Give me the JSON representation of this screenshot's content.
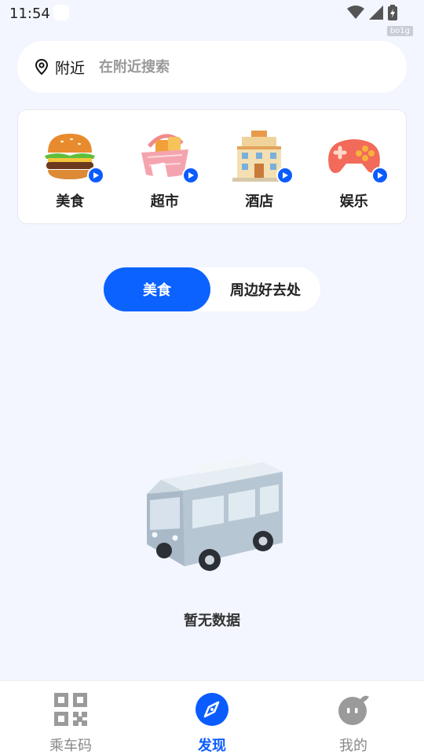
{
  "status_bar": {
    "time": "11:54",
    "build_tag": "bo1g"
  },
  "search": {
    "location_label": "附近",
    "placeholder": "在附近搜索"
  },
  "categories": [
    {
      "label": "美食",
      "icon": "burger-icon"
    },
    {
      "label": "超市",
      "icon": "shopping-basket-icon"
    },
    {
      "label": "酒店",
      "icon": "hotel-icon"
    },
    {
      "label": "娱乐",
      "icon": "gamepad-icon"
    }
  ],
  "tabs": {
    "active": "美食",
    "inactive": "周边好去处"
  },
  "empty": {
    "text": "暂无数据"
  },
  "nav": {
    "ride": "乘车码",
    "discover": "发现",
    "mine": "我的"
  },
  "colors": {
    "accent": "#0b62ff",
    "background": "#f3f6fe"
  }
}
